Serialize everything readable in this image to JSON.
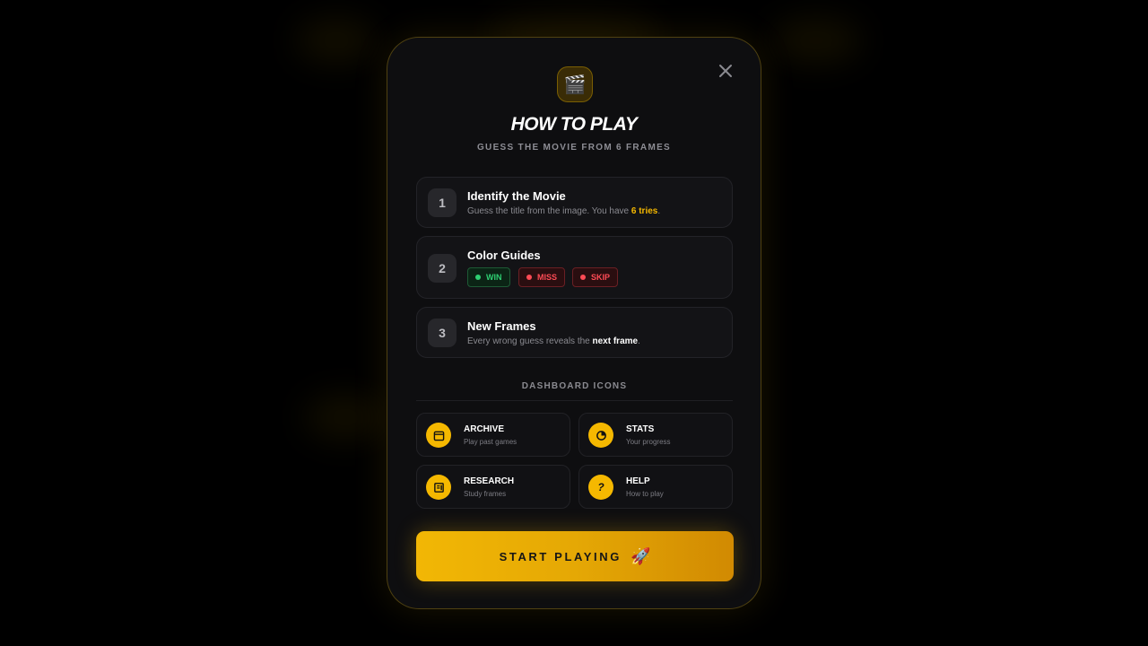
{
  "modal": {
    "title": "HOW TO PLAY",
    "subtitle": "GUESS THE MOVIE FROM 6 FRAMES",
    "logo_icon": "clapperboard-icon",
    "logo_glyph": "🎬"
  },
  "steps": [
    {
      "number": "1",
      "title": "Identify the Movie",
      "desc_before": "Guess the title from the image. You have ",
      "desc_highlight": "6 tries",
      "desc_after": "."
    },
    {
      "number": "2",
      "title": "Color Guides",
      "badges": [
        "WIN",
        "MISS",
        "SKIP"
      ]
    },
    {
      "number": "3",
      "title": "New Frames",
      "desc_before": "Every wrong guess reveals the ",
      "desc_highlight": "next frame",
      "desc_after": "."
    }
  ],
  "dashboard": {
    "heading": "DASHBOARD ICONS",
    "items": [
      {
        "title": "ARCHIVE",
        "subtitle": "Play past games",
        "icon": "calendar-icon"
      },
      {
        "title": "STATS",
        "subtitle": "Your progress",
        "icon": "pie-chart-icon"
      },
      {
        "title": "RESEARCH",
        "subtitle": "Study frames",
        "icon": "book-icon"
      },
      {
        "title": "HELP",
        "subtitle": "How to play",
        "icon": "question-icon",
        "glyph": "?"
      }
    ]
  },
  "cta": {
    "label": "START PLAYING",
    "icon": "rocket-icon",
    "glyph": "🚀"
  },
  "colors": {
    "accent": "#f5b800",
    "win": "#2ed072",
    "miss": "#ff4b55",
    "modal_bg": "#0e0e10",
    "page_bg": "#000000"
  }
}
